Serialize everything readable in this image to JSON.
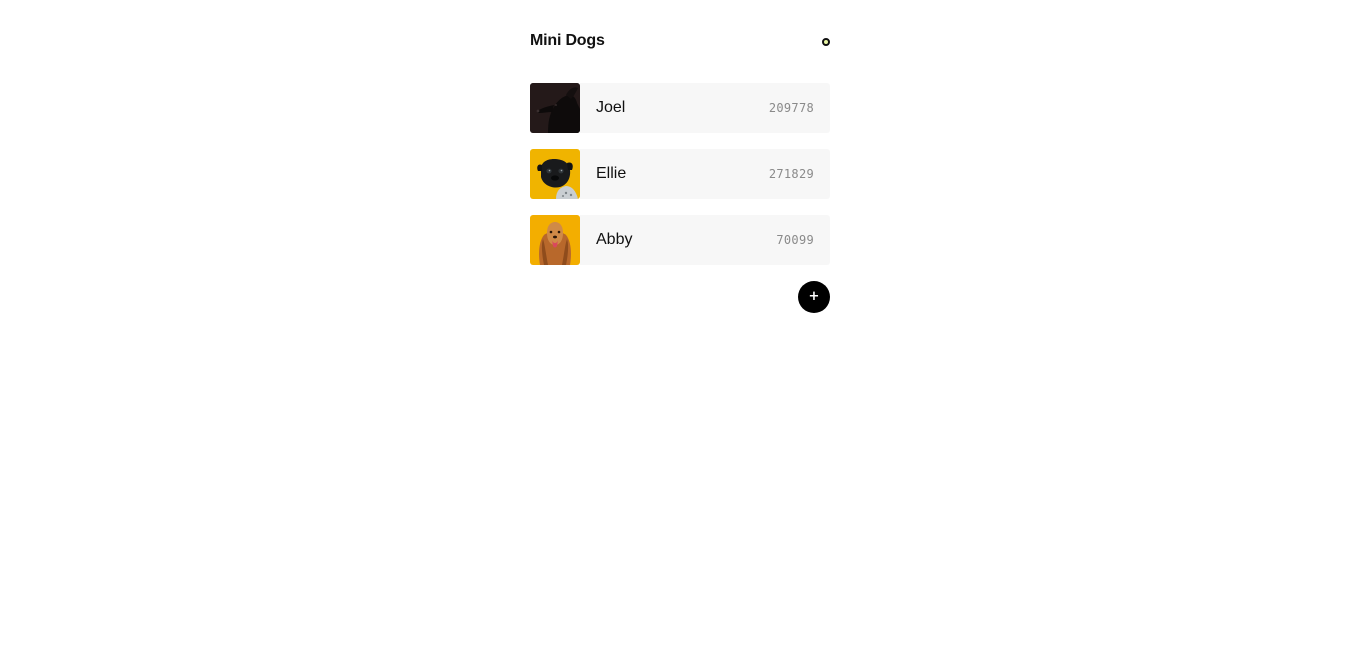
{
  "header": {
    "title": "Mini Dogs",
    "status_icon": "status-ring-icon"
  },
  "dogs": [
    {
      "name": "Joel",
      "count": "209778",
      "photo": "black-dog-photo",
      "photo_bg": "#1e1515"
    },
    {
      "name": "Ellie",
      "count": "271829",
      "photo": "pug-photo",
      "photo_bg": "#f0b400"
    },
    {
      "name": "Abby",
      "count": "70099",
      "photo": "spaniel-photo",
      "photo_bg": "#f3ae00"
    }
  ],
  "add_button": {
    "label": "+",
    "icon": "plus-icon"
  },
  "colors": {
    "card_bg": "#f7f7f7",
    "count_text": "#8a8a8a",
    "accent_dark": "#000000",
    "status_fill": "#e8f5a3"
  }
}
